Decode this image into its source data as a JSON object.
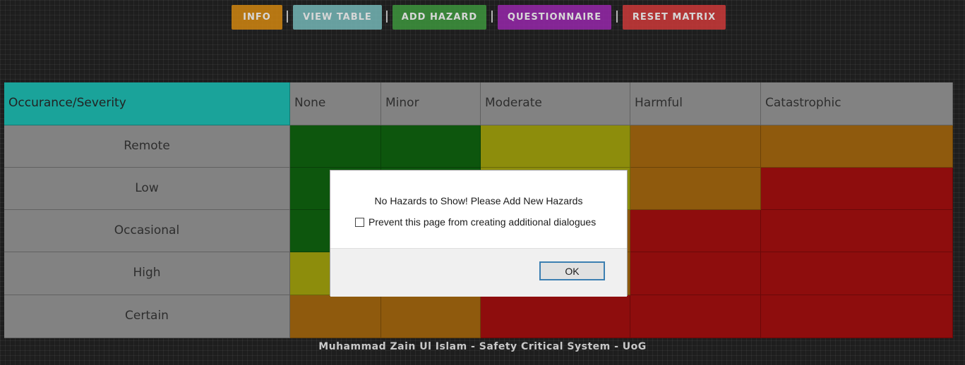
{
  "toolbar": {
    "buttons": [
      {
        "label": "INFO",
        "color": "#d88a10"
      },
      {
        "label": "VIEW TABLE",
        "color": "#78bcbc"
      },
      {
        "label": "ADD HAZARD",
        "color": "#3e9a3e"
      },
      {
        "label": "QUESTIONNAIRE",
        "color": "#9b27b0"
      },
      {
        "label": "RESET MATRIX",
        "color": "#d23a3a"
      }
    ],
    "separator": "|"
  },
  "matrix": {
    "corner_label": "Occurance/Severity",
    "severity": [
      "None",
      "Minor",
      "Moderate",
      "Harmful",
      "Catastrophic"
    ],
    "occurrence": [
      "Remote",
      "Low",
      "Occasional",
      "High",
      "Certain"
    ],
    "cell_levels": [
      [
        "green",
        "green",
        "yellow",
        "orange",
        "orange"
      ],
      [
        "green",
        "green",
        "yellow",
        "orange",
        "red"
      ],
      [
        "green",
        "green",
        "orange",
        "red",
        "red"
      ],
      [
        "yellow",
        "yellow",
        "orange",
        "red",
        "red"
      ],
      [
        "orange",
        "orange",
        "red",
        "red",
        "red"
      ]
    ],
    "level_colors": {
      "green": "#0d560d",
      "yellow": "#8d8d0c",
      "orange": "#8f5a0d",
      "red": "#8e0d0d"
    }
  },
  "dialog": {
    "message": "No Hazards to Show! Please Add New Hazards",
    "checkbox_label": "Prevent this page from creating additional dialogues",
    "checkbox_checked": false,
    "ok_label": "OK"
  },
  "footer": {
    "text": "Muhammad Zain Ul Islam - Safety Critical System - UoG"
  }
}
